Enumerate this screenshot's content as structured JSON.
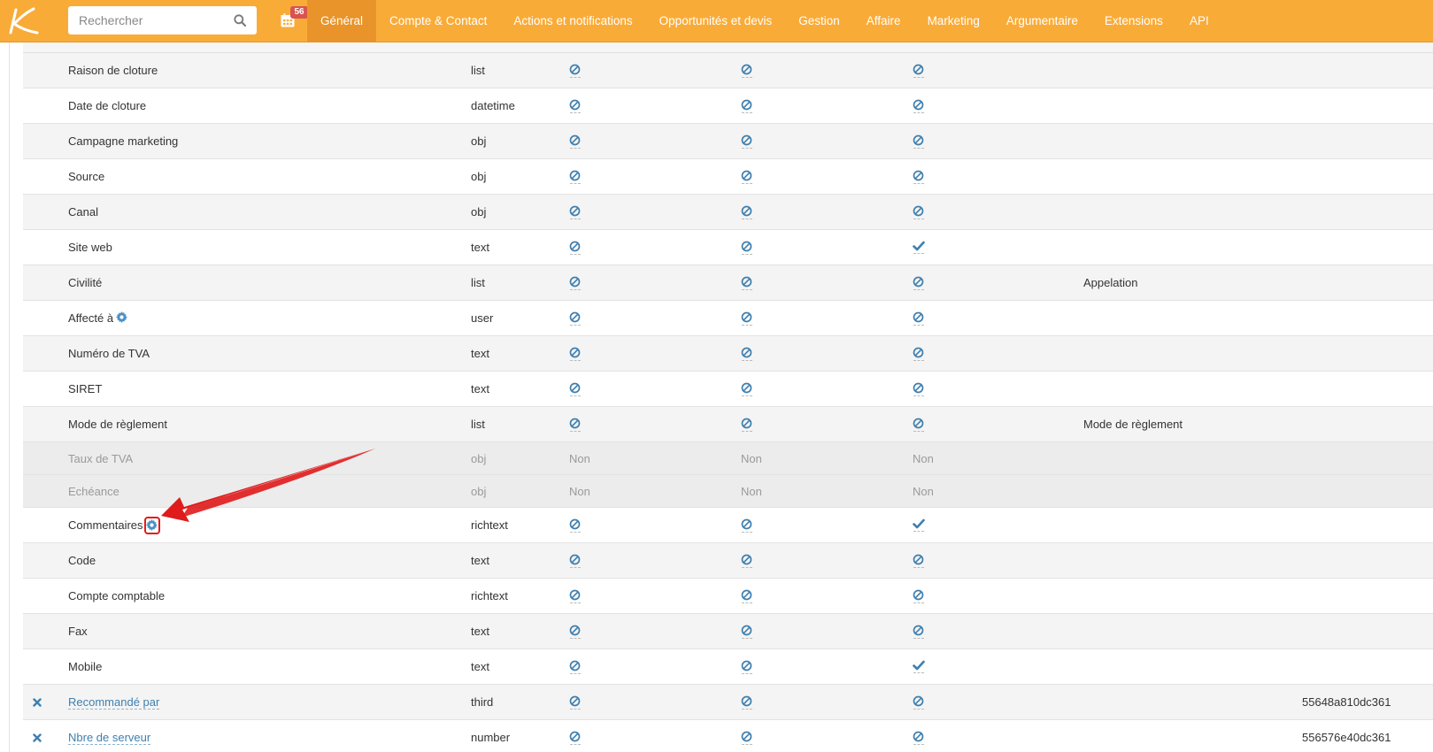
{
  "header": {
    "search_placeholder": "Rechercher",
    "notification_count": "56",
    "nav": [
      {
        "label": "Général"
      },
      {
        "label": "Compte & Contact"
      },
      {
        "label": "Actions et notifications"
      },
      {
        "label": "Opportunités et devis"
      },
      {
        "label": "Gestion"
      },
      {
        "label": "Affaire"
      },
      {
        "label": "Marketing"
      },
      {
        "label": "Argumentaire"
      },
      {
        "label": "Extensions"
      },
      {
        "label": "API"
      }
    ],
    "active_tab": "Général",
    "bar_color": "#f9ab38"
  },
  "rows": [
    {
      "name": "Raison de cloture",
      "type": "list",
      "flags": [
        "ban",
        "ban",
        "ban"
      ],
      "label": "",
      "id": ""
    },
    {
      "name": "Date de cloture",
      "type": "datetime",
      "flags": [
        "ban",
        "ban",
        "ban"
      ],
      "label": "",
      "id": ""
    },
    {
      "name": "Campagne marketing",
      "type": "obj",
      "flags": [
        "ban",
        "ban",
        "ban"
      ],
      "label": "",
      "id": ""
    },
    {
      "name": "Source",
      "type": "obj",
      "flags": [
        "ban",
        "ban",
        "ban"
      ],
      "label": "",
      "id": ""
    },
    {
      "name": "Canal",
      "type": "obj",
      "flags": [
        "ban",
        "ban",
        "ban"
      ],
      "label": "",
      "id": ""
    },
    {
      "name": "Site web",
      "type": "text",
      "flags": [
        "ban",
        "ban",
        "check"
      ],
      "label": "",
      "id": ""
    },
    {
      "name": "Civilité",
      "type": "list",
      "flags": [
        "ban",
        "ban",
        "ban"
      ],
      "label": "Appelation",
      "id": ""
    },
    {
      "name": "Affecté à",
      "type": "user",
      "flags": [
        "ban",
        "ban",
        "ban"
      ],
      "label": "",
      "id": "",
      "gear": true
    },
    {
      "name": "Numéro de TVA",
      "type": "text",
      "flags": [
        "ban",
        "ban",
        "ban"
      ],
      "label": "",
      "id": ""
    },
    {
      "name": "SIRET",
      "type": "text",
      "flags": [
        "ban",
        "ban",
        "ban"
      ],
      "label": "",
      "id": ""
    },
    {
      "name": "Mode de règlement",
      "type": "list",
      "flags": [
        "ban",
        "ban",
        "ban"
      ],
      "label": "Mode de règlement",
      "id": ""
    },
    {
      "name": "Taux de TVA",
      "type": "obj",
      "flags": [
        "Non",
        "Non",
        "Non"
      ],
      "label": "",
      "id": "",
      "disabled": true
    },
    {
      "name": "Echéance",
      "type": "obj",
      "flags": [
        "Non",
        "Non",
        "Non"
      ],
      "label": "",
      "id": "",
      "disabled": true
    },
    {
      "name": "Commentaires",
      "type": "richtext",
      "flags": [
        "ban",
        "ban",
        "check"
      ],
      "label": "",
      "id": "",
      "gear": true,
      "highlighted": true
    },
    {
      "name": "Code",
      "type": "text",
      "flags": [
        "ban",
        "ban",
        "ban"
      ],
      "label": "",
      "id": ""
    },
    {
      "name": "Compte comptable",
      "type": "richtext",
      "flags": [
        "ban",
        "ban",
        "ban"
      ],
      "label": "",
      "id": ""
    },
    {
      "name": "Fax",
      "type": "text",
      "flags": [
        "ban",
        "ban",
        "ban"
      ],
      "label": "",
      "id": ""
    },
    {
      "name": "Mobile",
      "type": "text",
      "flags": [
        "ban",
        "ban",
        "check"
      ],
      "label": "",
      "id": ""
    },
    {
      "name": "Recommandé par",
      "type": "third",
      "flags": [
        "ban",
        "ban",
        "ban"
      ],
      "label": "",
      "id": "55648a810dc361",
      "deletable": true,
      "link": true
    },
    {
      "name": "Nbre de serveur",
      "type": "number",
      "flags": [
        "ban",
        "ban",
        "ban"
      ],
      "label": "",
      "id": "556576e40dc361",
      "deletable": true,
      "link": true
    }
  ],
  "colors": {
    "icon_blue": "#3f7fae",
    "annotation_red": "#e01b1b"
  },
  "icons": {
    "ban": "ban-icon",
    "check": "check-icon",
    "gear": "gear-icon",
    "delete": "close-icon",
    "search": "search-icon",
    "calendar": "calendar-icon"
  }
}
